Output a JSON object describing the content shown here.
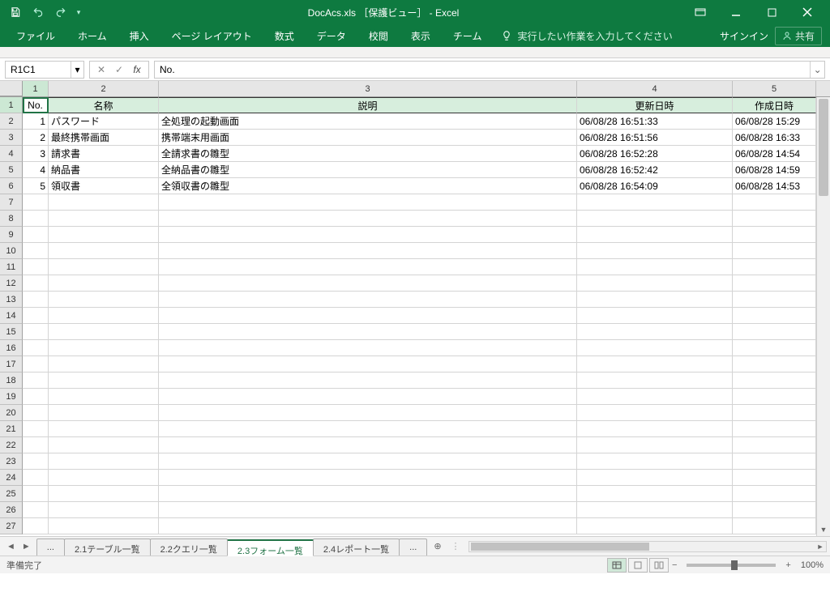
{
  "window": {
    "title": "DocAcs.xls ［保護ビュー］ - Excel",
    "signin": "サインイン",
    "share": "共有"
  },
  "ribbon": {
    "tabs": [
      "ファイル",
      "ホーム",
      "挿入",
      "ページ レイアウト",
      "数式",
      "データ",
      "校閲",
      "表示",
      "チーム"
    ],
    "tell_me": "実行したい作業を入力してください"
  },
  "namebox": {
    "value": "R1C1"
  },
  "formula": {
    "value": "No."
  },
  "cols": [
    "1",
    "2",
    "3",
    "4",
    "5"
  ],
  "headers": {
    "c1": "No.",
    "c2": "名称",
    "c3": "説明",
    "c4": "更新日時",
    "c5": "作成日時"
  },
  "data": [
    {
      "no": "1",
      "name": "パスワード",
      "desc": "全処理の起動画面",
      "upd": "06/08/28 16:51:33",
      "cre": "06/08/28 15:29"
    },
    {
      "no": "2",
      "name": "最終携帯画面",
      "desc": "携帯端末用画面",
      "upd": "06/08/28 16:51:56",
      "cre": "06/08/28 16:33"
    },
    {
      "no": "3",
      "name": "請求書",
      "desc": "全請求書の雛型",
      "upd": "06/08/28 16:52:28",
      "cre": "06/08/28 14:54"
    },
    {
      "no": "4",
      "name": "納品書",
      "desc": "全納品書の雛型",
      "upd": "06/08/28 16:52:42",
      "cre": "06/08/28 14:59"
    },
    {
      "no": "5",
      "name": "領収書",
      "desc": "全領収書の雛型",
      "upd": "06/08/28 16:54:09",
      "cre": "06/08/28 14:53"
    }
  ],
  "sheets": {
    "ellipsis_left": "...",
    "tabs": [
      "2.1テーブル一覧",
      "2.2クエリ一覧",
      "2.3フォーム一覧",
      "2.4レポート一覧"
    ],
    "active_index": 2,
    "ellipsis_right": "..."
  },
  "status": {
    "ready": "準備完了",
    "zoom": "100%"
  }
}
